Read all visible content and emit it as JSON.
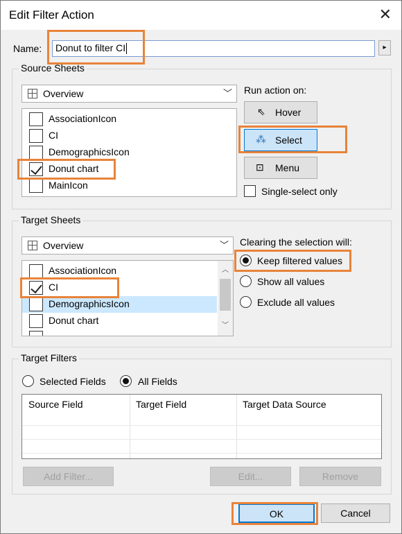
{
  "window": {
    "title": "Edit Filter Action",
    "close_symbol": "✕"
  },
  "name_field": {
    "label": "Name:",
    "value": "Donut to filter CI",
    "menu_arrow": "▸"
  },
  "source_sheets": {
    "group_title": "Source Sheets",
    "dropdown_value": "Overview",
    "items": [
      {
        "label": "AssociationIcon",
        "checked": false
      },
      {
        "label": "CI",
        "checked": false
      },
      {
        "label": "DemographicsIcon",
        "checked": false
      },
      {
        "label": "Donut chart",
        "checked": true
      },
      {
        "label": "MainIcon",
        "checked": false
      }
    ]
  },
  "run_action": {
    "label": "Run action on:",
    "buttons": {
      "hover": "Hover",
      "select": "Select",
      "menu": "Menu"
    },
    "selected": "Select",
    "single_select_label": "Single-select only"
  },
  "target_sheets": {
    "group_title": "Target Sheets",
    "dropdown_value": "Overview",
    "items": [
      {
        "label": "AssociationIcon",
        "checked": false
      },
      {
        "label": "CI",
        "checked": true
      },
      {
        "label": "DemographicsIcon",
        "checked": false,
        "highlighted": true
      },
      {
        "label": "Donut chart",
        "checked": false
      }
    ]
  },
  "clearing": {
    "label": "Clearing the selection will:",
    "options": {
      "keep": "Keep filtered values",
      "show_all": "Show all values",
      "exclude_all": "Exclude all values"
    },
    "selected": "Keep filtered values"
  },
  "target_filters": {
    "group_title": "Target Filters",
    "radio": {
      "selected_fields": "Selected Fields",
      "all_fields": "All Fields"
    },
    "selected": "All Fields",
    "columns": [
      "Source Field",
      "Target Field",
      "Target Data Source"
    ],
    "buttons": {
      "add": "Add Filter...",
      "edit": "Edit...",
      "remove": "Remove"
    }
  },
  "footer": {
    "ok": "OK",
    "cancel": "Cancel"
  },
  "colors": {
    "highlight": "#e8833a",
    "selection": "#cce8ff",
    "active_button": "#cce4f7"
  }
}
